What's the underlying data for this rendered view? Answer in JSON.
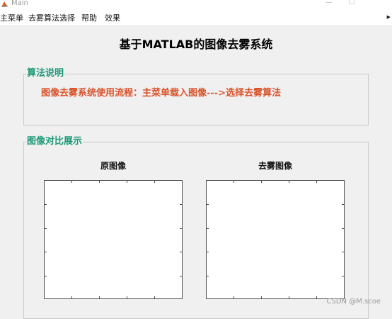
{
  "window": {
    "title": "Main",
    "icon": "matlab-icon",
    "controls": {
      "minimize": "—",
      "maximize": "☐"
    }
  },
  "menubar": {
    "items": [
      {
        "label": "主菜单"
      },
      {
        "label": "去雾算法选择"
      },
      {
        "label": "帮助"
      },
      {
        "label": "效果"
      }
    ],
    "overflow_icon": "chevron-right-icon"
  },
  "main": {
    "title": "基于MATLAB的图像去雾系统"
  },
  "algorithm_panel": {
    "title": "算法说明",
    "text": "图像去雾系统使用流程：主菜单载入图像--->选择去雾算法"
  },
  "comparison_panel": {
    "title": "图像对比展示",
    "original_label": "原图像",
    "dehazed_label": "去雾图像"
  },
  "watermark": "CSDN @M.scoe",
  "colors": {
    "panel_title": "#1e9a78",
    "description_text": "#d9532b",
    "background": "#f0f0f0"
  }
}
